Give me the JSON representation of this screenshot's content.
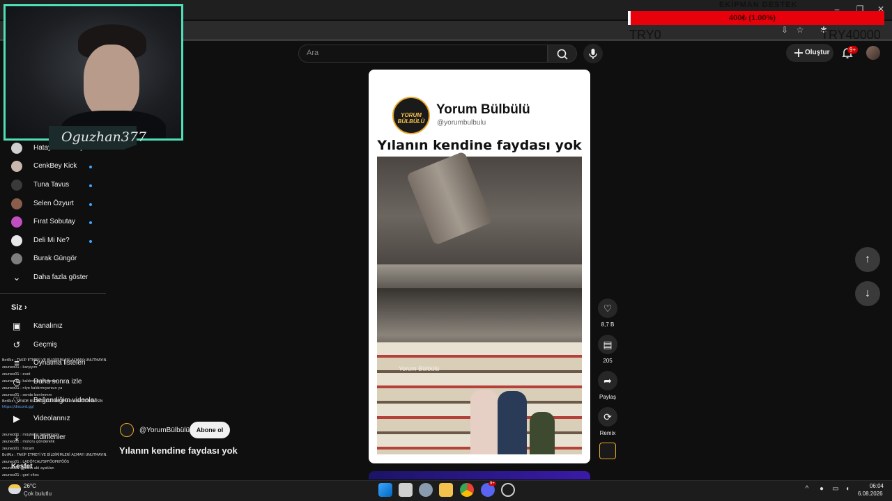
{
  "search": {
    "placeholder": "Ara"
  },
  "header": {
    "create_label": "Oluştur",
    "notifications_badge": "9+"
  },
  "overlay": {
    "donation_title": "EKİPMAN DESTEK",
    "donation_progress_text": "400₺ (1.00%)",
    "donation_progress_fraction": 0.01,
    "donation_min_label": "TRY0",
    "donation_max_label": "TRY40000",
    "streamer_name": "Oguzhan377"
  },
  "sidebar": {
    "subscriptions": [
      {
        "label": "Hatay Sandık İçi",
        "new": false
      },
      {
        "label": "CenkBey Kick",
        "new": true
      },
      {
        "label": "Tuna Tavus",
        "new": true
      },
      {
        "label": "Selen Özyurt",
        "new": true
      },
      {
        "label": "Fırat Sobutay",
        "new": true
      },
      {
        "label": "Deli Mi Ne?",
        "new": true
      },
      {
        "label": "Burak Güngör",
        "new": false
      }
    ],
    "show_more": "Daha fazla göster",
    "you_heading": "Siz",
    "you_items": [
      {
        "label": "Kanalınız",
        "icon": "channel-icon"
      },
      {
        "label": "Geçmiş",
        "icon": "history-icon"
      },
      {
        "label": "Oynatma listeleri",
        "icon": "playlist-icon"
      },
      {
        "label": "Daha sonra izle",
        "icon": "clock-icon"
      },
      {
        "label": "Beğendiğim videolar",
        "icon": "like-icon"
      },
      {
        "label": "Videolarınız",
        "icon": "video-icon"
      },
      {
        "label": "İndirilenler",
        "icon": "download-icon"
      },
      {
        "label": "Keşfet",
        "icon": "explore-icon"
      }
    ]
  },
  "chat": [
    "BotRix : TAKİP ETMEYİ VE BİLDİRİMLERİ AÇMAYI UNUTMAYIN.",
    "zeuneo01 : karşıyım",
    "zeuneo01 : evet",
    "zeuneo01 : kaldırmak istiyorum",
    "zeuneo01 : niye kaldırmıyorsun ya",
    "zeuneo01 : sende benimmm",
    "BotRix : SENDE BU OYUNLARI BEDAVA ALMAK İSTERMİSİN",
    "https://discord.gg/",
    "zeuneo01 : müşterisi bekleniyor",
    "zeuneo01 : motoru gönderelik",
    "zeuneo01 : hocam",
    "BotRix : TAKİP ETMEYİ VE BİLDİRİMLERİ AÇMAYI UNUTMAYIN.",
    "zeuneo01 : LADÖFCALFSPFÖOPKFÖÖS",
    "zeuneo01 : gelsin abi ayaklan",
    "zeuneo01 : geri vites"
  ],
  "short": {
    "channel_name": "Yorum Bülbülü",
    "channel_handle": "@yorumbulbulu",
    "logo_text": "YORUM BÜLBÜLÜ",
    "headline": "Yılanın kendine faydası yok",
    "video_watermark": "Yorum Bülbülü",
    "info_channel": "@YorumBülbülü",
    "subscribe_label": "Abone ol",
    "info_title": "Yılanın kendine faydası yok"
  },
  "actions": {
    "likes": "8,7 B",
    "comments": "205",
    "share": "Paylaş",
    "remix": "Remix"
  },
  "taskbar": {
    "temperature": "26°C",
    "weather": "Çok bulutlu",
    "time": "06:04",
    "date": "6.08.2026",
    "discord_badge": "9+"
  }
}
